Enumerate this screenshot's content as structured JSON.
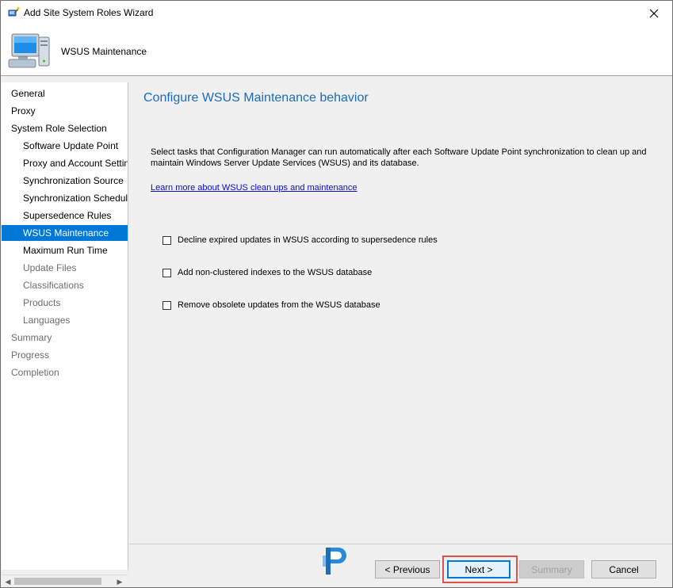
{
  "window": {
    "title": "Add Site System Roles Wizard"
  },
  "header": {
    "title": "WSUS Maintenance"
  },
  "nav": {
    "items": [
      {
        "label": "General",
        "level": 0,
        "state": "done"
      },
      {
        "label": "Proxy",
        "level": 0,
        "state": "done"
      },
      {
        "label": "System Role Selection",
        "level": 0,
        "state": "done"
      },
      {
        "label": "Software Update Point",
        "level": 1,
        "state": "done"
      },
      {
        "label": "Proxy and Account Settings",
        "level": 1,
        "state": "done"
      },
      {
        "label": "Synchronization Source",
        "level": 1,
        "state": "done"
      },
      {
        "label": "Synchronization Schedule",
        "level": 1,
        "state": "done"
      },
      {
        "label": "Supersedence Rules",
        "level": 1,
        "state": "done"
      },
      {
        "label": "WSUS Maintenance",
        "level": 1,
        "state": "selected"
      },
      {
        "label": "Maximum Run Time",
        "level": 1,
        "state": "done"
      },
      {
        "label": "Update Files",
        "level": 1,
        "state": "pending"
      },
      {
        "label": "Classifications",
        "level": 1,
        "state": "pending"
      },
      {
        "label": "Products",
        "level": 1,
        "state": "pending"
      },
      {
        "label": "Languages",
        "level": 1,
        "state": "pending"
      },
      {
        "label": "Summary",
        "level": 0,
        "state": "pending"
      },
      {
        "label": "Progress",
        "level": 0,
        "state": "pending"
      },
      {
        "label": "Completion",
        "level": 0,
        "state": "pending"
      }
    ]
  },
  "content": {
    "title": "Configure WSUS Maintenance behavior",
    "description": "Select tasks that Configuration Manager can run automatically after each Software Update Point synchronization to clean up and maintain Windows Server Update Services (WSUS) and its database.",
    "learn_more": "Learn more about WSUS clean ups and maintenance",
    "options": [
      {
        "label": "Decline expired updates in WSUS according to supersedence rules",
        "checked": false
      },
      {
        "label": "Add non-clustered indexes to the WSUS database",
        "checked": false
      },
      {
        "label": "Remove obsolete updates from the WSUS database",
        "checked": false
      }
    ]
  },
  "buttons": {
    "previous": "< Previous",
    "next": "Next >",
    "summary": "Summary",
    "cancel": "Cancel"
  },
  "colors": {
    "accent": "#0078d7",
    "title_blue": "#1e6bb8",
    "highlight": "#d9534f"
  }
}
